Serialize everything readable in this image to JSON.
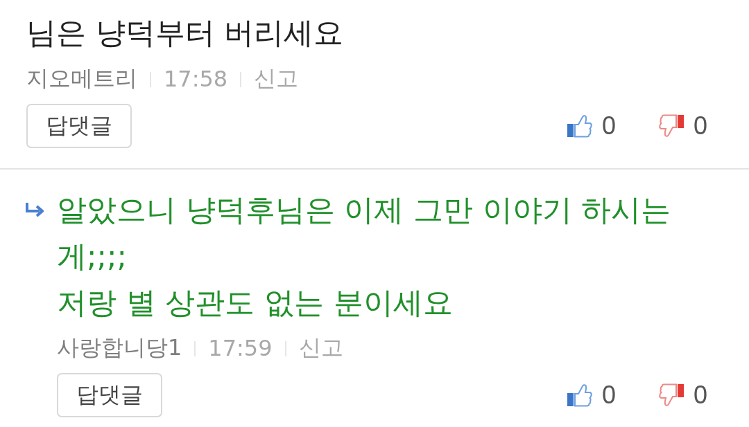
{
  "comments": [
    {
      "kind": "comment",
      "lines": [
        "님은 냥덕부터 버리세요"
      ],
      "author": "지오메트리",
      "time": "17:58",
      "report": "신고",
      "reply_button": "답댓글",
      "likes": "0",
      "dislikes": "0"
    },
    {
      "kind": "reply",
      "lines": [
        "알았으니 냥덕후님은 이제 그만 이야기 하시는 게;;;;",
        "저랑 별 상관도 없는 분이세요"
      ],
      "author": "사랑합니당1",
      "time": "17:59",
      "report": "신고",
      "reply_button": "답댓글",
      "likes": "0",
      "dislikes": "0"
    }
  ]
}
